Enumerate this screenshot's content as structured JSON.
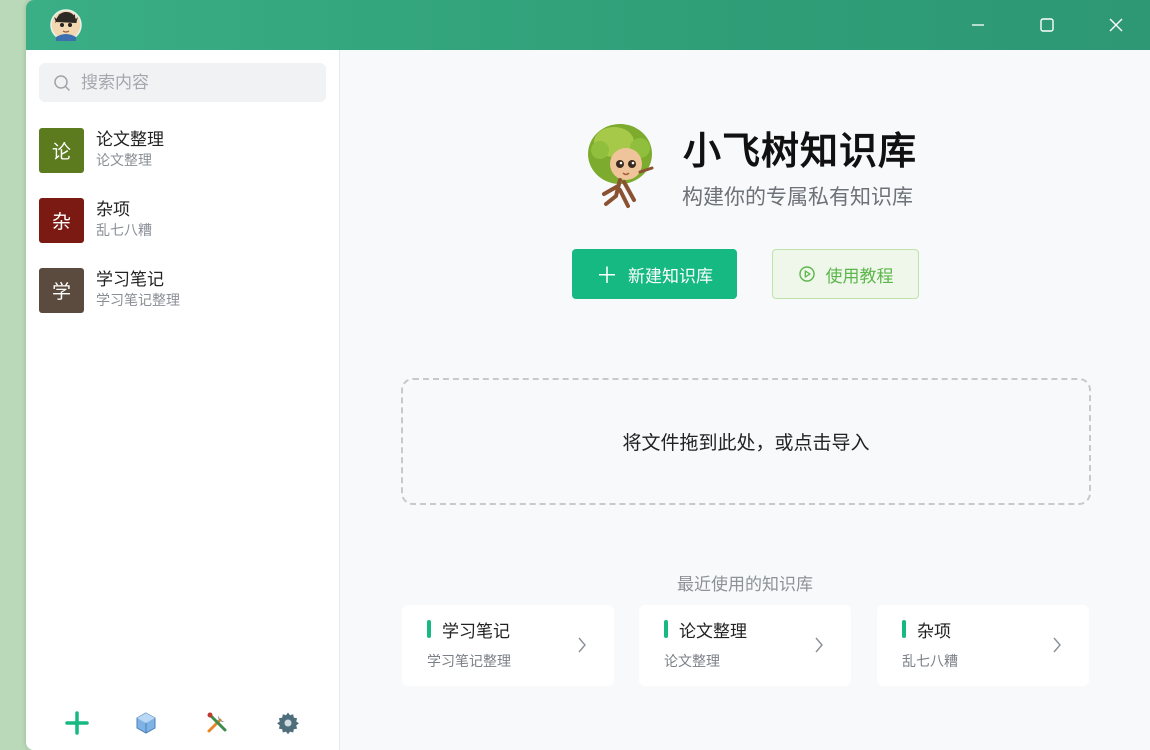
{
  "titlebar": {
    "logo_icon": "mascot-avatar-icon",
    "accent_color": "#2f9f78"
  },
  "sidebar": {
    "search": {
      "placeholder": "搜索内容",
      "value": ""
    },
    "items": [
      {
        "avatar": "论",
        "name": "论文整理",
        "desc": "论文整理",
        "color": "#5c7a1e"
      },
      {
        "avatar": "杂",
        "name": "杂项",
        "desc": "乱七八糟",
        "color": "#7a1a12"
      },
      {
        "avatar": "学",
        "name": "学习笔记",
        "desc": "学习笔记整理",
        "color": "#5b4b3f"
      }
    ],
    "tools": [
      "add-icon",
      "cube-icon",
      "tools-icon",
      "gear-icon"
    ]
  },
  "main": {
    "title": "小飞树知识库",
    "subtitle": "构建你的专属私有知识库",
    "new_button": "新建知识库",
    "guide_button": "使用教程",
    "dropzone_text": "将文件拖到此处，或点击导入",
    "recent_title": "最近使用的知识库",
    "recent": [
      {
        "name": "学习笔记",
        "desc": "学习笔记整理"
      },
      {
        "name": "论文整理",
        "desc": "论文整理"
      },
      {
        "name": "杂项",
        "desc": "乱七八糟"
      }
    ],
    "brand_color": "#15b981"
  }
}
